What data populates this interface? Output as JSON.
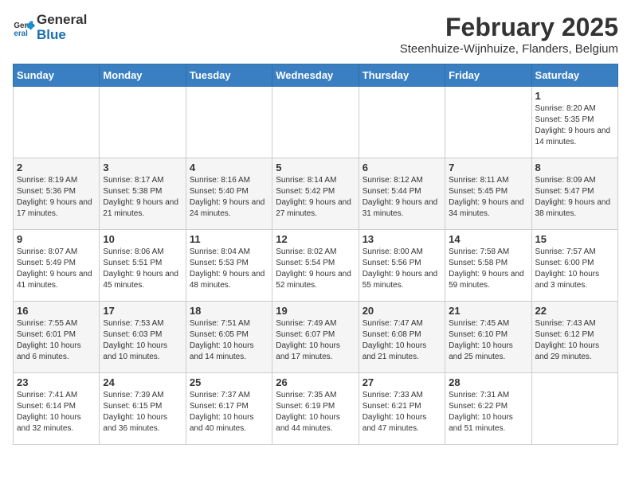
{
  "logo": {
    "line1": "General",
    "line2": "Blue"
  },
  "title": "February 2025",
  "subtitle": "Steenhuize-Wijnhuize, Flanders, Belgium",
  "days_of_week": [
    "Sunday",
    "Monday",
    "Tuesday",
    "Wednesday",
    "Thursday",
    "Friday",
    "Saturday"
  ],
  "weeks": [
    [
      {
        "day": "",
        "info": ""
      },
      {
        "day": "",
        "info": ""
      },
      {
        "day": "",
        "info": ""
      },
      {
        "day": "",
        "info": ""
      },
      {
        "day": "",
        "info": ""
      },
      {
        "day": "",
        "info": ""
      },
      {
        "day": "1",
        "info": "Sunrise: 8:20 AM\nSunset: 5:35 PM\nDaylight: 9 hours and 14 minutes."
      }
    ],
    [
      {
        "day": "2",
        "info": "Sunrise: 8:19 AM\nSunset: 5:36 PM\nDaylight: 9 hours and 17 minutes."
      },
      {
        "day": "3",
        "info": "Sunrise: 8:17 AM\nSunset: 5:38 PM\nDaylight: 9 hours and 21 minutes."
      },
      {
        "day": "4",
        "info": "Sunrise: 8:16 AM\nSunset: 5:40 PM\nDaylight: 9 hours and 24 minutes."
      },
      {
        "day": "5",
        "info": "Sunrise: 8:14 AM\nSunset: 5:42 PM\nDaylight: 9 hours and 27 minutes."
      },
      {
        "day": "6",
        "info": "Sunrise: 8:12 AM\nSunset: 5:44 PM\nDaylight: 9 hours and 31 minutes."
      },
      {
        "day": "7",
        "info": "Sunrise: 8:11 AM\nSunset: 5:45 PM\nDaylight: 9 hours and 34 minutes."
      },
      {
        "day": "8",
        "info": "Sunrise: 8:09 AM\nSunset: 5:47 PM\nDaylight: 9 hours and 38 minutes."
      }
    ],
    [
      {
        "day": "9",
        "info": "Sunrise: 8:07 AM\nSunset: 5:49 PM\nDaylight: 9 hours and 41 minutes."
      },
      {
        "day": "10",
        "info": "Sunrise: 8:06 AM\nSunset: 5:51 PM\nDaylight: 9 hours and 45 minutes."
      },
      {
        "day": "11",
        "info": "Sunrise: 8:04 AM\nSunset: 5:53 PM\nDaylight: 9 hours and 48 minutes."
      },
      {
        "day": "12",
        "info": "Sunrise: 8:02 AM\nSunset: 5:54 PM\nDaylight: 9 hours and 52 minutes."
      },
      {
        "day": "13",
        "info": "Sunrise: 8:00 AM\nSunset: 5:56 PM\nDaylight: 9 hours and 55 minutes."
      },
      {
        "day": "14",
        "info": "Sunrise: 7:58 AM\nSunset: 5:58 PM\nDaylight: 9 hours and 59 minutes."
      },
      {
        "day": "15",
        "info": "Sunrise: 7:57 AM\nSunset: 6:00 PM\nDaylight: 10 hours and 3 minutes."
      }
    ],
    [
      {
        "day": "16",
        "info": "Sunrise: 7:55 AM\nSunset: 6:01 PM\nDaylight: 10 hours and 6 minutes."
      },
      {
        "day": "17",
        "info": "Sunrise: 7:53 AM\nSunset: 6:03 PM\nDaylight: 10 hours and 10 minutes."
      },
      {
        "day": "18",
        "info": "Sunrise: 7:51 AM\nSunset: 6:05 PM\nDaylight: 10 hours and 14 minutes."
      },
      {
        "day": "19",
        "info": "Sunrise: 7:49 AM\nSunset: 6:07 PM\nDaylight: 10 hours and 17 minutes."
      },
      {
        "day": "20",
        "info": "Sunrise: 7:47 AM\nSunset: 6:08 PM\nDaylight: 10 hours and 21 minutes."
      },
      {
        "day": "21",
        "info": "Sunrise: 7:45 AM\nSunset: 6:10 PM\nDaylight: 10 hours and 25 minutes."
      },
      {
        "day": "22",
        "info": "Sunrise: 7:43 AM\nSunset: 6:12 PM\nDaylight: 10 hours and 29 minutes."
      }
    ],
    [
      {
        "day": "23",
        "info": "Sunrise: 7:41 AM\nSunset: 6:14 PM\nDaylight: 10 hours and 32 minutes."
      },
      {
        "day": "24",
        "info": "Sunrise: 7:39 AM\nSunset: 6:15 PM\nDaylight: 10 hours and 36 minutes."
      },
      {
        "day": "25",
        "info": "Sunrise: 7:37 AM\nSunset: 6:17 PM\nDaylight: 10 hours and 40 minutes."
      },
      {
        "day": "26",
        "info": "Sunrise: 7:35 AM\nSunset: 6:19 PM\nDaylight: 10 hours and 44 minutes."
      },
      {
        "day": "27",
        "info": "Sunrise: 7:33 AM\nSunset: 6:21 PM\nDaylight: 10 hours and 47 minutes."
      },
      {
        "day": "28",
        "info": "Sunrise: 7:31 AM\nSunset: 6:22 PM\nDaylight: 10 hours and 51 minutes."
      },
      {
        "day": "",
        "info": ""
      }
    ]
  ]
}
